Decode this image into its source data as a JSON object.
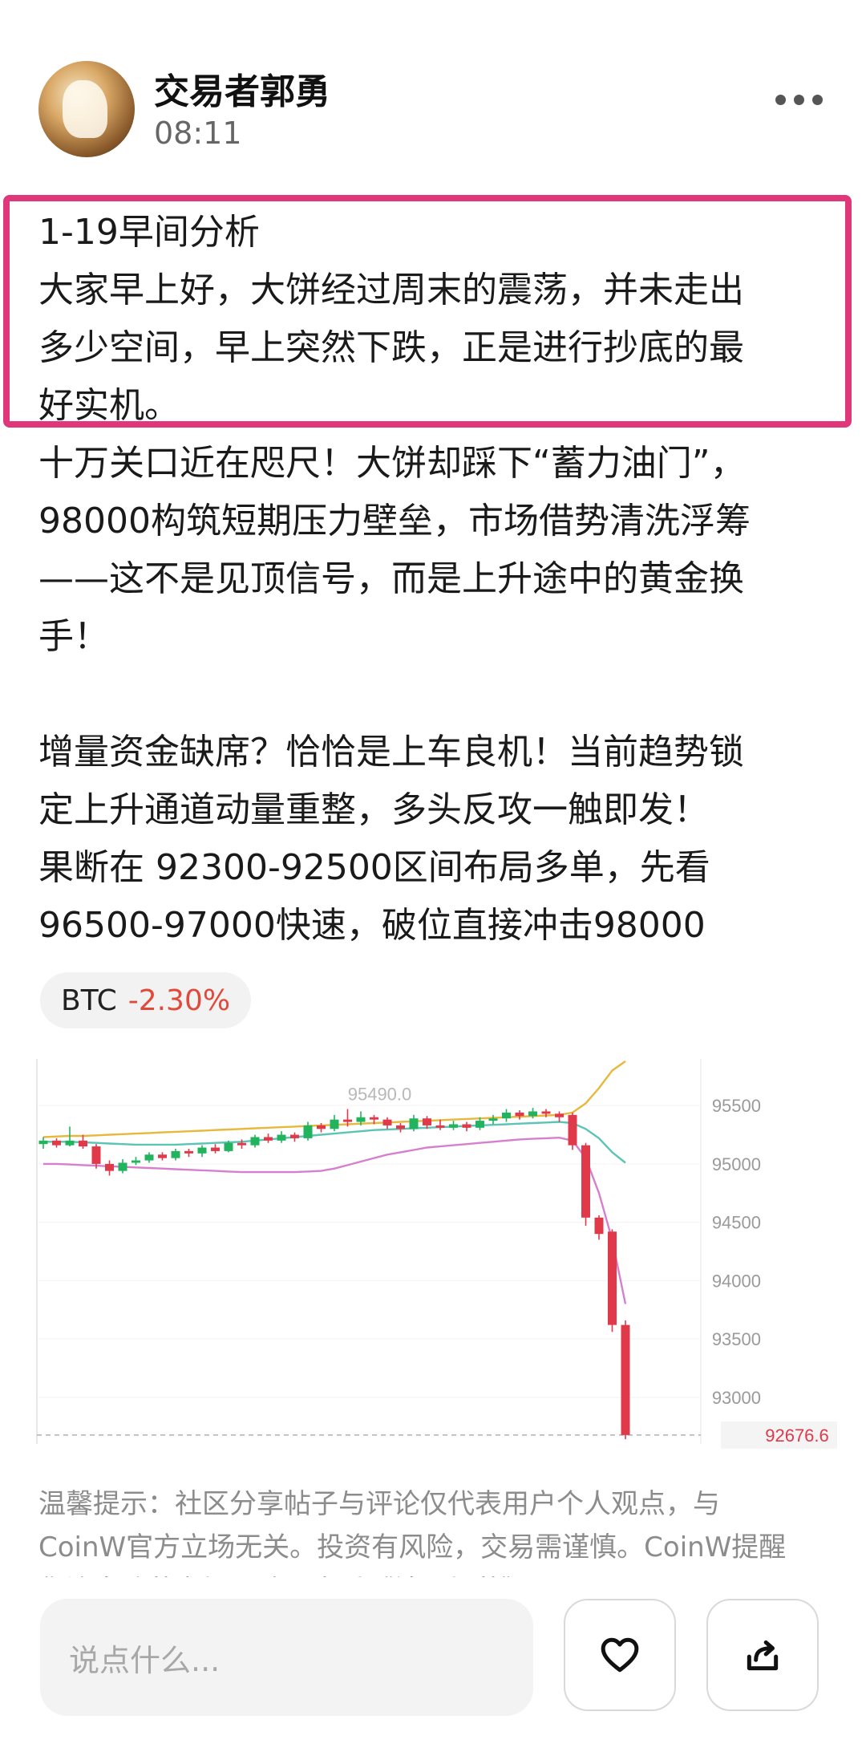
{
  "post": {
    "author": "交易者郭勇",
    "time": "08:11",
    "highlight_lines": [
      "1-19早间分析",
      "大家早上好，大饼经过周末的震荡，并未走出",
      "多少空间，早上突然下跌，正是进行抄底的最",
      "好实机。"
    ],
    "paragraph2": [
      "十万关口近在咫尺！大饼却踩下“蓄力油门”，",
      "98000构筑短期压力壁垒，市场借势清洗浮筹",
      "——这不是见顶信号，而是上升途中的黄金换",
      "手！"
    ],
    "paragraph3": [
      "增量资金缺席？恰恰是上车良机！当前趋势锁",
      "定上升通道动量重整，多头反攻一触即发！",
      "果断在 92300-92500区间布局多单，先看",
      "96500-97000快速，破位直接冲击98000"
    ]
  },
  "tag": {
    "symbol": "BTC",
    "change": "-2.30%"
  },
  "chart_data": {
    "type": "candlestick",
    "y_ticks": [
      "95500",
      "95000",
      "94500",
      "94000",
      "93500",
      "93000"
    ],
    "ylim": [
      92600,
      95900
    ],
    "high_label": "95490.0",
    "last_price": "92676.6",
    "colors": {
      "up": "#22b35e",
      "down": "#e0394a",
      "ma_yellow": "#e8b83c",
      "ma_teal": "#5cc4b4",
      "ma_pink": "#d77fcf"
    },
    "candles": [
      [
        95170,
        95200,
        95130,
        95230
      ],
      [
        95200,
        95160,
        95140,
        95220
      ],
      [
        95160,
        95200,
        95150,
        95320
      ],
      [
        95200,
        95150,
        95130,
        95250
      ],
      [
        95150,
        95000,
        94960,
        95170
      ],
      [
        95000,
        94940,
        94900,
        95030
      ],
      [
        94940,
        95010,
        94920,
        95040
      ],
      [
        95010,
        95030,
        94990,
        95060
      ],
      [
        95030,
        95080,
        95010,
        95100
      ],
      [
        95080,
        95050,
        95030,
        95100
      ],
      [
        95050,
        95110,
        95030,
        95130
      ],
      [
        95110,
        95090,
        95060,
        95130
      ],
      [
        95090,
        95140,
        95060,
        95160
      ],
      [
        95140,
        95110,
        95090,
        95170
      ],
      [
        95110,
        95180,
        95100,
        95200
      ],
      [
        95180,
        95160,
        95130,
        95210
      ],
      [
        95160,
        95230,
        95140,
        95250
      ],
      [
        95230,
        95200,
        95180,
        95260
      ],
      [
        95200,
        95250,
        95180,
        95280
      ],
      [
        95250,
        95220,
        95190,
        95270
      ],
      [
        95220,
        95330,
        95200,
        95360
      ],
      [
        95330,
        95300,
        95270,
        95350
      ],
      [
        95300,
        95380,
        95280,
        95420
      ],
      [
        95380,
        95360,
        95320,
        95470
      ],
      [
        95360,
        95400,
        95330,
        95450
      ],
      [
        95400,
        95380,
        95340,
        95420
      ],
      [
        95380,
        95330,
        95300,
        95400
      ],
      [
        95330,
        95300,
        95270,
        95350
      ],
      [
        95300,
        95390,
        95280,
        95420
      ],
      [
        95390,
        95330,
        95300,
        95410
      ],
      [
        95330,
        95310,
        95290,
        95380
      ],
      [
        95310,
        95340,
        95290,
        95370
      ],
      [
        95340,
        95310,
        95280,
        95360
      ],
      [
        95310,
        95370,
        95290,
        95400
      ],
      [
        95370,
        95390,
        95340,
        95420
      ],
      [
        95390,
        95440,
        95360,
        95470
      ],
      [
        95440,
        95410,
        95380,
        95460
      ],
      [
        95410,
        95450,
        95390,
        95480
      ],
      [
        95450,
        95430,
        95400,
        95470
      ],
      [
        95430,
        95400,
        95360,
        95450
      ],
      [
        95420,
        95160,
        95120,
        95440
      ],
      [
        95160,
        94540,
        94470,
        95180
      ],
      [
        94540,
        94400,
        94350,
        94560
      ],
      [
        94420,
        93620,
        93560,
        94440
      ],
      [
        93620,
        92676.6,
        92640,
        93660
      ]
    ],
    "ma_yellow": [
      95230,
      95235,
      95240,
      95240,
      95245,
      95250,
      95255,
      95260,
      95265,
      95270,
      95275,
      95280,
      95285,
      95290,
      95295,
      95300,
      95305,
      95310,
      95315,
      95320,
      95325,
      95330,
      95335,
      95340,
      95345,
      95350,
      95355,
      95360,
      95365,
      95370,
      95375,
      95380,
      95385,
      95390,
      95395,
      95400,
      95405,
      95410,
      95415,
      95420,
      95440,
      95520,
      95650,
      95800,
      95880
    ],
    "ma_teal": [
      95190,
      95190,
      95190,
      95185,
      95180,
      95175,
      95170,
      95165,
      95165,
      95165,
      95165,
      95170,
      95175,
      95180,
      95185,
      95190,
      95200,
      95210,
      95220,
      95230,
      95240,
      95250,
      95260,
      95270,
      95280,
      95290,
      95295,
      95300,
      95305,
      95310,
      95315,
      95320,
      95325,
      95330,
      95335,
      95340,
      95345,
      95350,
      95355,
      95360,
      95350,
      95300,
      95220,
      95100,
      95010
    ],
    "ma_pink": [
      95000,
      95000,
      94995,
      94990,
      94985,
      94980,
      94975,
      94970,
      94965,
      94960,
      94955,
      94950,
      94945,
      94940,
      94935,
      94930,
      94930,
      94930,
      94930,
      94930,
      94935,
      94940,
      94960,
      94990,
      95020,
      95050,
      95080,
      95100,
      95120,
      95140,
      95150,
      95160,
      95170,
      95180,
      95190,
      95200,
      95210,
      95215,
      95220,
      95225,
      95200,
      95050,
      94750,
      94350,
      93800
    ]
  },
  "notice": {
    "line1": "温馨提示：社区分享帖子与评论仅代表用户个人观点，与",
    "line2": "CoinW官方立场无关。投资有风险，交易需谨慎。CoinW提醒",
    "line3": "您注意防范市场风险，查看《社区规范》"
  },
  "bottom": {
    "comment_placeholder": "说点什么..."
  }
}
